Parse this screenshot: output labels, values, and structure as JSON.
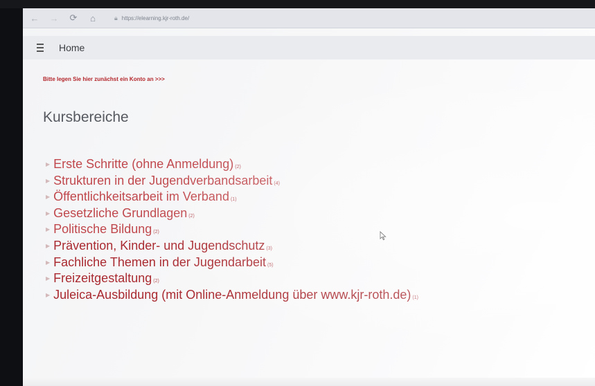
{
  "browser": {
    "url": "https://elearning.kjr-roth.de/",
    "back_icon": "arrow-left-icon",
    "forward_icon": "arrow-right-icon",
    "refresh_icon": "refresh-icon",
    "home_icon": "home-icon",
    "lock_icon": "lock-icon"
  },
  "navbar": {
    "menu_icon": "hamburger-menu-icon",
    "home_label": "Home"
  },
  "notice": {
    "text": "Bitte legen Sie hier zunächst ein Konto an >>>"
  },
  "main": {
    "heading": "Kursbereiche",
    "categories": [
      {
        "name": "Erste Schritte (ohne Anmeldung)",
        "count": "(2)"
      },
      {
        "name": "Strukturen in der Jugendverbandsarbeit",
        "count": "(4)"
      },
      {
        "name": "Öffentlichkeitsarbeit im Verband",
        "count": "(1)"
      },
      {
        "name": "Gesetzliche Grundlagen",
        "count": "(2)"
      },
      {
        "name": "Politische Bildung",
        "count": "(2)"
      },
      {
        "name": "Prävention, Kinder- und Jugendschutz",
        "count": "(3)"
      },
      {
        "name": "Fachliche Themen in der Jugendarbeit",
        "count": "(5)"
      },
      {
        "name": "Freizeitgestaltung",
        "count": "(2)"
      },
      {
        "name": "Juleica-Ausbildung (mit Online-Anmeldung über www.kjr-roth.de)",
        "count": "(1)"
      }
    ]
  },
  "cursor_icon": "mouse-pointer-icon",
  "colors": {
    "link": "#c0484d",
    "notice": "#b3262b",
    "heading": "#565a60"
  }
}
